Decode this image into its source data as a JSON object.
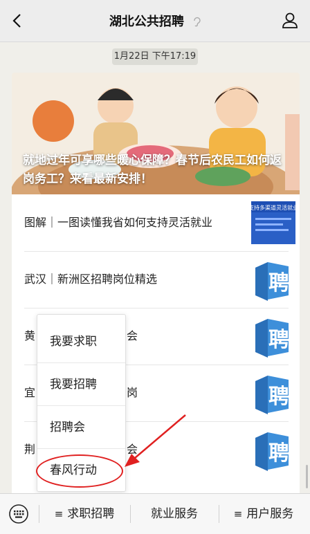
{
  "header": {
    "title": "湖北公共招聘"
  },
  "timestamp": "1月22日 下午17:19",
  "hero": {
    "title": "就地过年可享哪些暖心保障？春节后农民工如何返岗务工？来看最新安排！"
  },
  "articles": [
    {
      "title": "图解｜一图读懂我省如何支持灵活就业",
      "thumb_text": "支持多渠道灵活就业"
    },
    {
      "title": "武汉｜新洲区招聘岗位精选",
      "thumb_text": "聘"
    },
    {
      "title": "黄",
      "thumb_text": "聘"
    },
    {
      "title": "宜",
      "thumb_text": "聘"
    },
    {
      "title": "荆",
      "thumb_text": "聘"
    }
  ],
  "article_tail_chars": [
    "",
    "",
    "会",
    "岗",
    "会"
  ],
  "popup_menu": {
    "items": [
      "我要求职",
      "我要招聘",
      "招聘会",
      "春风行动"
    ]
  },
  "bottom_menu": {
    "tabs": [
      "求职招聘",
      "就业服务",
      "用户服务"
    ]
  },
  "colors": {
    "accent_red": "#e02020",
    "thumb_blue": "#2a86d4"
  }
}
